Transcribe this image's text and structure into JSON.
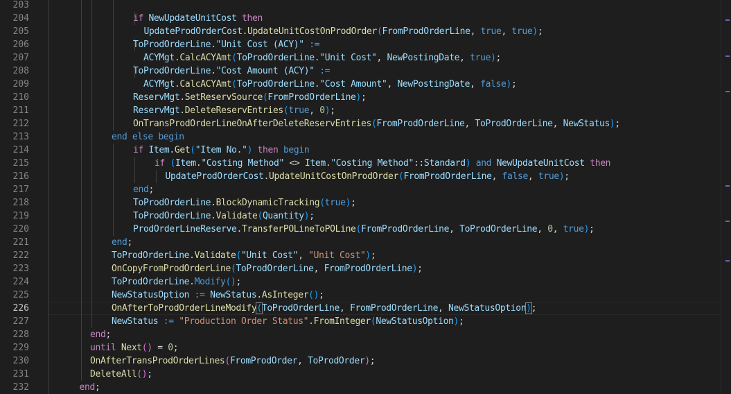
{
  "editor": {
    "active_line": 226,
    "lines": [
      {
        "n": 203,
        "indent": 0,
        "t": []
      },
      {
        "n": 204,
        "indent": 8,
        "t": [
          [
            "if",
            "kw"
          ],
          [
            " ",
            ""
          ],
          [
            "NewUpdateUnitCost",
            "var"
          ],
          [
            " ",
            ""
          ],
          [
            "then",
            "kw"
          ]
        ]
      },
      {
        "n": 205,
        "indent": 9,
        "t": [
          [
            "UpdateProdOrderCost",
            "var"
          ],
          [
            ".",
            ""
          ],
          [
            "UpdateUnitCostOnProdOrder",
            "fn"
          ],
          [
            "(",
            "pb"
          ],
          [
            "FromProdOrderLine",
            "var"
          ],
          [
            ", ",
            ""
          ],
          [
            "true",
            "kb"
          ],
          [
            ", ",
            ""
          ],
          [
            "true",
            "kb"
          ],
          [
            ")",
            "pb"
          ],
          [
            ";",
            ""
          ]
        ]
      },
      {
        "n": 206,
        "indent": 8,
        "t": [
          [
            "ToProdOrderLine",
            "var"
          ],
          [
            ".",
            ""
          ],
          [
            "\"Unit Cost (ACY)\"",
            "var"
          ],
          [
            " ",
            ""
          ],
          [
            ":=",
            "kb"
          ]
        ]
      },
      {
        "n": 207,
        "indent": 8,
        "pre": "  ",
        "t": [
          [
            "ACYMgt",
            "var"
          ],
          [
            ".",
            ""
          ],
          [
            "CalcACYAmt",
            "fn"
          ],
          [
            "(",
            "pb"
          ],
          [
            "ToProdOrderLine",
            "var"
          ],
          [
            ".",
            ""
          ],
          [
            "\"Unit Cost\"",
            "var"
          ],
          [
            ", ",
            ""
          ],
          [
            "NewPostingDate",
            "var"
          ],
          [
            ", ",
            ""
          ],
          [
            "true",
            "kb"
          ],
          [
            ")",
            "pb"
          ],
          [
            ";",
            ""
          ]
        ]
      },
      {
        "n": 208,
        "indent": 8,
        "t": [
          [
            "ToProdOrderLine",
            "var"
          ],
          [
            ".",
            ""
          ],
          [
            "\"Cost Amount (ACY)\"",
            "var"
          ],
          [
            " ",
            ""
          ],
          [
            ":=",
            "kb"
          ]
        ]
      },
      {
        "n": 209,
        "indent": 8,
        "pre": "  ",
        "t": [
          [
            "ACYMgt",
            "var"
          ],
          [
            ".",
            ""
          ],
          [
            "CalcACYAmt",
            "fn"
          ],
          [
            "(",
            "pb"
          ],
          [
            "ToProdOrderLine",
            "var"
          ],
          [
            ".",
            ""
          ],
          [
            "\"Cost Amount\"",
            "var"
          ],
          [
            ", ",
            ""
          ],
          [
            "NewPostingDate",
            "var"
          ],
          [
            ", ",
            ""
          ],
          [
            "false",
            "kb"
          ],
          [
            ")",
            "pb"
          ],
          [
            ";",
            ""
          ]
        ]
      },
      {
        "n": 210,
        "indent": 8,
        "t": [
          [
            "ReservMgt",
            "var"
          ],
          [
            ".",
            ""
          ],
          [
            "SetReservSource",
            "fn"
          ],
          [
            "(",
            "pb"
          ],
          [
            "FromProdOrderLine",
            "var"
          ],
          [
            ")",
            "pb"
          ],
          [
            ";",
            ""
          ]
        ]
      },
      {
        "n": 211,
        "indent": 8,
        "t": [
          [
            "ReservMgt",
            "var"
          ],
          [
            ".",
            ""
          ],
          [
            "DeleteReservEntries",
            "fn"
          ],
          [
            "(",
            "pb"
          ],
          [
            "true",
            "kb"
          ],
          [
            ", ",
            ""
          ],
          [
            "0",
            "num"
          ],
          [
            ")",
            "pb"
          ],
          [
            ";",
            ""
          ]
        ]
      },
      {
        "n": 212,
        "indent": 8,
        "t": [
          [
            "OnTransProdOrderLineOnAfterDeleteReservEntries",
            "fn"
          ],
          [
            "(",
            "pb"
          ],
          [
            "FromProdOrderLine",
            "var"
          ],
          [
            ", ",
            ""
          ],
          [
            "ToProdOrderLine",
            "var"
          ],
          [
            ", ",
            ""
          ],
          [
            "NewStatus",
            "var"
          ],
          [
            ")",
            "pb"
          ],
          [
            ";",
            ""
          ]
        ]
      },
      {
        "n": 213,
        "indent": 6,
        "t": [
          [
            "end",
            "kb"
          ],
          [
            " ",
            ""
          ],
          [
            "else",
            "kb"
          ],
          [
            " ",
            ""
          ],
          [
            "begin",
            "kb"
          ]
        ]
      },
      {
        "n": 214,
        "indent": 8,
        "t": [
          [
            "if",
            "kw"
          ],
          [
            " ",
            ""
          ],
          [
            "Item",
            "var"
          ],
          [
            ".",
            ""
          ],
          [
            "Get",
            "fn"
          ],
          [
            "(",
            "pb"
          ],
          [
            "\"Item No.\"",
            "var"
          ],
          [
            ")",
            "pb"
          ],
          [
            " ",
            ""
          ],
          [
            "then",
            "kw"
          ],
          [
            " ",
            ""
          ],
          [
            "begin",
            "kb"
          ]
        ]
      },
      {
        "n": 215,
        "indent": 10,
        "t": [
          [
            "if",
            "kw"
          ],
          [
            " ",
            ""
          ],
          [
            "(",
            "pb"
          ],
          [
            "Item",
            "var"
          ],
          [
            ".",
            ""
          ],
          [
            "\"Costing Method\"",
            "var"
          ],
          [
            " <> ",
            ""
          ],
          [
            "Item",
            "var"
          ],
          [
            ".",
            ""
          ],
          [
            "\"Costing Method\"",
            "var"
          ],
          [
            "::",
            ""
          ],
          [
            "Standard",
            "var"
          ],
          [
            ")",
            "pb"
          ],
          [
            " ",
            ""
          ],
          [
            "and",
            "kb"
          ],
          [
            " ",
            ""
          ],
          [
            "NewUpdateUnitCost",
            "var"
          ],
          [
            " ",
            ""
          ],
          [
            "then",
            "kw"
          ]
        ]
      },
      {
        "n": 216,
        "indent": 11,
        "t": [
          [
            "UpdateProdOrderCost",
            "var"
          ],
          [
            ".",
            ""
          ],
          [
            "UpdateUnitCostOnProdOrder",
            "fn"
          ],
          [
            "(",
            "pb"
          ],
          [
            "FromProdOrderLine",
            "var"
          ],
          [
            ", ",
            ""
          ],
          [
            "false",
            "kb"
          ],
          [
            ", ",
            ""
          ],
          [
            "true",
            "kb"
          ],
          [
            ")",
            "pb"
          ],
          [
            ";",
            ""
          ]
        ]
      },
      {
        "n": 217,
        "indent": 8,
        "t": [
          [
            "end",
            "kb"
          ],
          [
            ";",
            ""
          ]
        ]
      },
      {
        "n": 218,
        "indent": 8,
        "t": [
          [
            "ToProdOrderLine",
            "var"
          ],
          [
            ".",
            ""
          ],
          [
            "BlockDynamicTracking",
            "fn"
          ],
          [
            "(",
            "pb"
          ],
          [
            "true",
            "kb"
          ],
          [
            ")",
            "pb"
          ],
          [
            ";",
            ""
          ]
        ]
      },
      {
        "n": 219,
        "indent": 8,
        "t": [
          [
            "ToProdOrderLine",
            "var"
          ],
          [
            ".",
            ""
          ],
          [
            "Validate",
            "fn"
          ],
          [
            "(",
            "pb"
          ],
          [
            "Quantity",
            "var"
          ],
          [
            ")",
            "pb"
          ],
          [
            ";",
            ""
          ]
        ]
      },
      {
        "n": 220,
        "indent": 8,
        "t": [
          [
            "ProdOrderLineReserve",
            "var"
          ],
          [
            ".",
            ""
          ],
          [
            "TransferPOLineToPOLine",
            "fn"
          ],
          [
            "(",
            "pb"
          ],
          [
            "FromProdOrderLine",
            "var"
          ],
          [
            ", ",
            ""
          ],
          [
            "ToProdOrderLine",
            "var"
          ],
          [
            ", ",
            ""
          ],
          [
            "0",
            "num"
          ],
          [
            ", ",
            ""
          ],
          [
            "true",
            "kb"
          ],
          [
            ")",
            "pb"
          ],
          [
            ";",
            ""
          ]
        ]
      },
      {
        "n": 221,
        "indent": 6,
        "t": [
          [
            "end",
            "kb"
          ],
          [
            ";",
            ""
          ]
        ]
      },
      {
        "n": 222,
        "indent": 6,
        "t": [
          [
            "ToProdOrderLine",
            "var"
          ],
          [
            ".",
            ""
          ],
          [
            "Validate",
            "fn"
          ],
          [
            "(",
            "pb"
          ],
          [
            "\"Unit Cost\"",
            "var"
          ],
          [
            ", ",
            ""
          ],
          [
            "\"Unit Cost\"",
            "str"
          ],
          [
            ")",
            "pb"
          ],
          [
            ";",
            ""
          ]
        ]
      },
      {
        "n": 223,
        "indent": 6,
        "t": [
          [
            "OnCopyFromProdOrderLine",
            "fn"
          ],
          [
            "(",
            "pb"
          ],
          [
            "ToProdOrderLine",
            "var"
          ],
          [
            ", ",
            ""
          ],
          [
            "FromProdOrderLine",
            "var"
          ],
          [
            ")",
            "pb"
          ],
          [
            ";",
            ""
          ]
        ]
      },
      {
        "n": 224,
        "indent": 6,
        "t": [
          [
            "ToProdOrderLine",
            "var"
          ],
          [
            ".",
            ""
          ],
          [
            "Modify",
            "kb"
          ],
          [
            "(",
            "pb"
          ],
          [
            ")",
            "pb"
          ],
          [
            ";",
            ""
          ]
        ]
      },
      {
        "n": 225,
        "indent": 6,
        "t": [
          [
            "NewStatusOption",
            "var"
          ],
          [
            " ",
            ""
          ],
          [
            ":=",
            "kb"
          ],
          [
            " ",
            ""
          ],
          [
            "NewStatus",
            "var"
          ],
          [
            ".",
            ""
          ],
          [
            "AsInteger",
            "fn"
          ],
          [
            "(",
            "pb"
          ],
          [
            ")",
            "pb"
          ],
          [
            ";",
            ""
          ]
        ]
      },
      {
        "n": 226,
        "indent": 6,
        "t": [
          [
            "OnAfterToProdOrderLineModify",
            "fn"
          ],
          [
            "(",
            "pb cur"
          ],
          [
            "ToProdOrderLine",
            "var"
          ],
          [
            ", ",
            ""
          ],
          [
            "FromProdOrderLine",
            "var"
          ],
          [
            ", ",
            ""
          ],
          [
            "NewStatusOption",
            "var"
          ],
          [
            ")",
            "pb cur"
          ],
          [
            ";",
            ""
          ]
        ]
      },
      {
        "n": 227,
        "indent": 6,
        "t": [
          [
            "NewStatus",
            "var"
          ],
          [
            " ",
            ""
          ],
          [
            ":=",
            "kb"
          ],
          [
            " ",
            ""
          ],
          [
            "\"Production Order Status\"",
            "str"
          ],
          [
            ".",
            ""
          ],
          [
            "FromInteger",
            "fn"
          ],
          [
            "(",
            "pb"
          ],
          [
            "NewStatusOption",
            "var"
          ],
          [
            ")",
            "pb"
          ],
          [
            ";",
            ""
          ]
        ]
      },
      {
        "n": 228,
        "indent": 4,
        "t": [
          [
            "end",
            "kw"
          ],
          [
            ";",
            ""
          ]
        ]
      },
      {
        "n": 229,
        "indent": 4,
        "t": [
          [
            "until",
            "kw"
          ],
          [
            " ",
            ""
          ],
          [
            "Next",
            "fn"
          ],
          [
            "(",
            "pk"
          ],
          [
            ")",
            "pk"
          ],
          [
            " = ",
            ""
          ],
          [
            "0",
            "num"
          ],
          [
            ";",
            ""
          ]
        ]
      },
      {
        "n": 230,
        "indent": 4,
        "t": [
          [
            "OnAfterTransProdOrderLines",
            "fn"
          ],
          [
            "(",
            "pk"
          ],
          [
            "FromProdOrder",
            "var"
          ],
          [
            ", ",
            ""
          ],
          [
            "ToProdOrder",
            "var"
          ],
          [
            ")",
            "pk"
          ],
          [
            ";",
            ""
          ]
        ]
      },
      {
        "n": 231,
        "indent": 4,
        "t": [
          [
            "DeleteAll",
            "fn"
          ],
          [
            "(",
            "pk"
          ],
          [
            ")",
            "pk"
          ],
          [
            ";",
            ""
          ]
        ]
      },
      {
        "n": 232,
        "indent": 3,
        "t": [
          [
            "end",
            "kw"
          ],
          [
            ";",
            ""
          ]
        ]
      }
    ]
  },
  "minimap_marks": [
    0.05,
    0.14,
    0.23,
    0.47,
    0.56,
    0.66
  ]
}
